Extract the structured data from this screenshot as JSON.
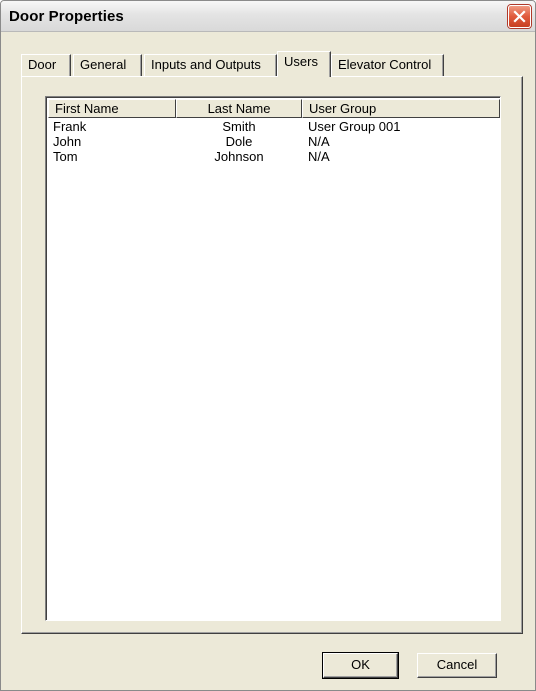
{
  "window": {
    "title": "Door Properties"
  },
  "tabs": [
    {
      "label": "Door"
    },
    {
      "label": "General"
    },
    {
      "label": "Inputs and Outputs"
    },
    {
      "label": "Users"
    },
    {
      "label": "Elevator Control"
    }
  ],
  "active_tab": "Users",
  "users_list": {
    "columns": [
      "First Name",
      "Last Name",
      "User Group"
    ],
    "rows": [
      {
        "first": "Frank",
        "last": "Smith",
        "group": "User Group 001"
      },
      {
        "first": "John",
        "last": "Dole",
        "group": "N/A"
      },
      {
        "first": "Tom",
        "last": "Johnson",
        "group": "N/A"
      }
    ]
  },
  "buttons": {
    "ok": "OK",
    "cancel": "Cancel"
  }
}
